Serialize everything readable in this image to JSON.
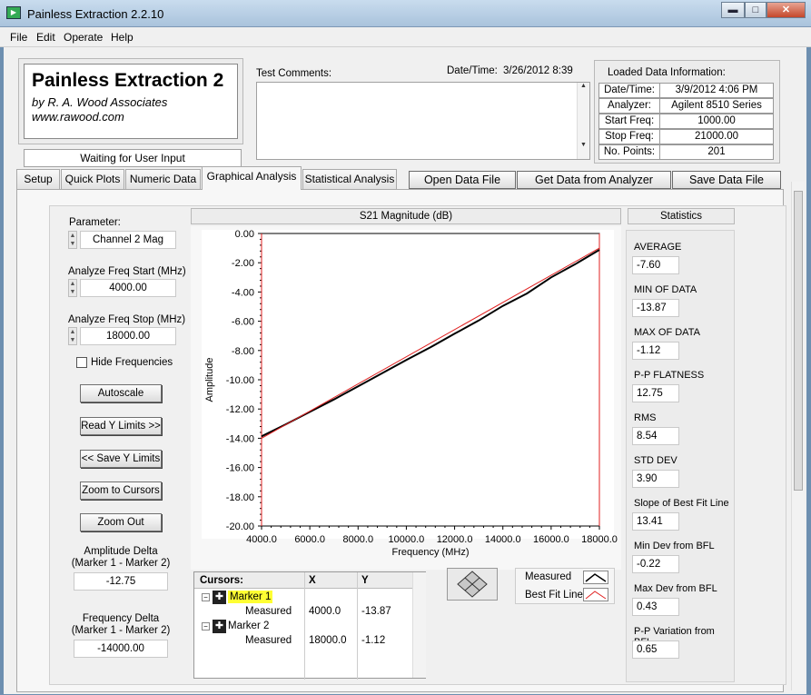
{
  "window": {
    "title": "Painless Extraction 2.2.10",
    "minimize": "▬",
    "restore": "□",
    "close": "✕"
  },
  "menu": [
    "File",
    "Edit",
    "Operate",
    "Help"
  ],
  "branding": {
    "title": "Painless Extraction 2",
    "subtitle": "by R. A. Wood Associates",
    "url": "www.rawood.com"
  },
  "status": "Waiting for User Input",
  "comments": {
    "label": "Test Comments:",
    "datetime_label": "Date/Time:",
    "datetime_value": "3/26/2012  8:39"
  },
  "loaded": {
    "title": "Loaded Data Information:",
    "rows": [
      {
        "label": "Date/Time:",
        "value": "3/9/2012 4:06 PM"
      },
      {
        "label": "Analyzer:",
        "value": "Agilent 8510 Series"
      },
      {
        "label": "Start Freq:",
        "value": "1000.00"
      },
      {
        "label": "Stop Freq:",
        "value": "21000.00"
      },
      {
        "label": "No. Points:",
        "value": "201"
      }
    ]
  },
  "tabs": [
    "Setup",
    "Quick Plots",
    "Numeric Data",
    "Graphical Analysis",
    "Statistical Analysis"
  ],
  "actions": {
    "open": "Open Data File",
    "get": "Get Data from Analyzer",
    "save": "Save Data File"
  },
  "controls": {
    "parameter_label": "Parameter:",
    "parameter_value": "Channel 2 Mag",
    "start_label": "Analyze Freq Start (MHz)",
    "start_value": "4000.00",
    "stop_label": "Analyze Freq Stop (MHz)",
    "stop_value": "18000.00",
    "hide_freq": "Hide Frequencies",
    "autoscale": "Autoscale",
    "read_y": "Read Y Limits >>",
    "save_y": "<< Save Y Limits",
    "zoom_cursors": "Zoom to Cursors",
    "zoom_out": "Zoom Out",
    "amp_delta_label1": "Amplitude Delta",
    "amp_delta_label2": "(Marker 1 - Marker 2)",
    "amp_delta_value": "-12.75",
    "freq_delta_label1": "Frequency Delta",
    "freq_delta_label2": "(Marker 1 - Marker 2)",
    "freq_delta_value": "-14000.00"
  },
  "cursors": {
    "header": [
      "Cursors:",
      "X",
      "Y"
    ],
    "markers": [
      {
        "name": "Marker 1",
        "sub": "Measured",
        "x": "4000.0",
        "y": "-13.87",
        "highlight": "#ffff33"
      },
      {
        "name": "Marker 2",
        "sub": "Measured",
        "x": "18000.0",
        "y": "-1.12"
      }
    ]
  },
  "legend": {
    "measured": "Measured",
    "bfl": "Best Fit Line"
  },
  "statistics": {
    "title": "Statistics",
    "items": [
      {
        "label": "AVERAGE",
        "value": "-7.60"
      },
      {
        "label": "MIN OF DATA",
        "value": "-13.87"
      },
      {
        "label": "MAX OF DATA",
        "value": "-1.12"
      },
      {
        "label": "P-P FLATNESS",
        "value": "12.75"
      },
      {
        "label": "RMS",
        "value": "8.54"
      },
      {
        "label": "STD DEV",
        "value": "3.90"
      },
      {
        "label": "Slope of Best Fit Line",
        "value": "13.41"
      },
      {
        "label": "Min Dev from BFL",
        "value": "-0.22"
      },
      {
        "label": "Max Dev from BFL",
        "value": "0.43"
      },
      {
        "label": "P-P Variation from BFL",
        "value": "0.65"
      }
    ]
  },
  "chart_data": {
    "type": "line",
    "title": "S21 Magnitude (dB)",
    "xlabel": "Frequency (MHz)",
    "ylabel": "Amplitude",
    "xlim": [
      4000,
      18000
    ],
    "ylim": [
      -20,
      0
    ],
    "xticks": [
      "4000.0",
      "6000.0",
      "8000.0",
      "10000.0",
      "12000.0",
      "14000.0",
      "16000.0",
      "18000.0"
    ],
    "yticks": [
      "0.00",
      "-2.00",
      "-4.00",
      "-6.00",
      "-8.00",
      "-10.00",
      "-12.00",
      "-14.00",
      "-16.00",
      "-18.00",
      "-20.00"
    ],
    "series": [
      {
        "name": "Measured",
        "color": "#000000",
        "x": [
          4000,
          5000,
          6000,
          7000,
          8000,
          9000,
          10000,
          11000,
          12000,
          13000,
          14000,
          15000,
          16000,
          17000,
          18000
        ],
        "y": [
          -13.87,
          -13.05,
          -12.2,
          -11.35,
          -10.45,
          -9.55,
          -8.65,
          -7.78,
          -6.85,
          -5.95,
          -4.95,
          -4.1,
          -3.0,
          -2.1,
          -1.12
        ]
      },
      {
        "name": "Best Fit Line",
        "color": "#e02020",
        "x": [
          4000,
          18000
        ],
        "y": [
          -14.0,
          -1.0
        ]
      }
    ],
    "cursors_x": [
      4000,
      18000
    ]
  }
}
